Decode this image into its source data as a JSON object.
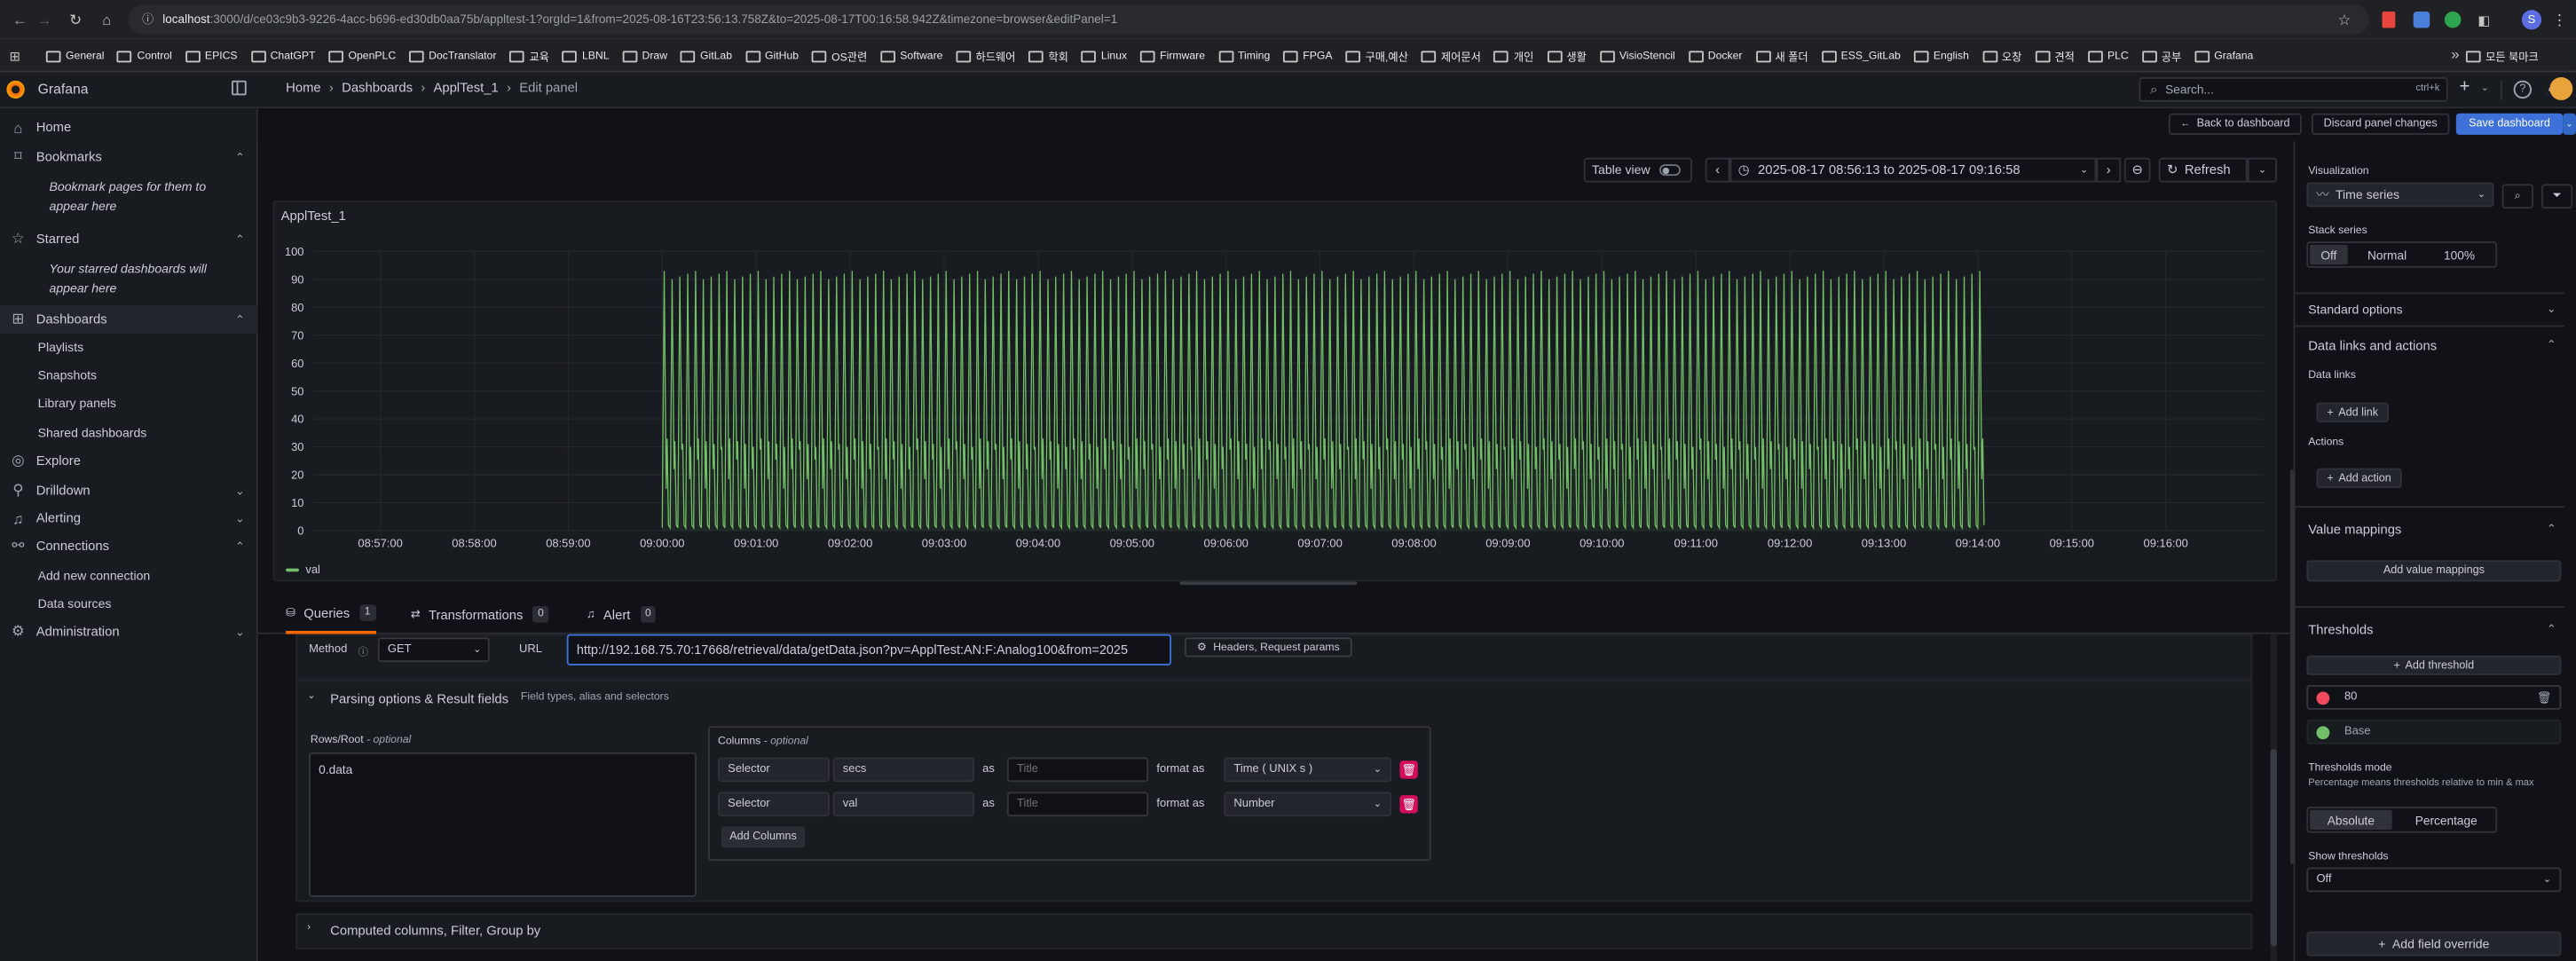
{
  "browser": {
    "url_host": "localhost",
    "url_rest": ":3000/d/ce03c9b3-9226-4acc-b696-ed30db0aa75b/appltest-1?orgId=1&from=2025-08-16T23:56:13.758Z&to=2025-08-17T00:16:58.942Z&timezone=browser&editPanel=1",
    "bookmarks": [
      "General",
      "Control",
      "EPICS",
      "ChatGPT",
      "OpenPLC",
      "DocTranslator",
      "교육",
      "LBNL",
      "Draw",
      "GitLab",
      "GitHub",
      "OS관련",
      "Software",
      "하드웨어",
      "학회",
      "Linux",
      "Firmware",
      "Timing",
      "FPGA",
      "구매,예산",
      "제어문서",
      "개인",
      "생활",
      "VisioStencil",
      "Docker",
      "새 폴더",
      "ESS_GitLab",
      "English",
      "오창",
      "견적",
      "PLC",
      "공부",
      "Grafana"
    ],
    "bookmarks_more": "»",
    "all_bookmarks": "모든 북마크",
    "profile": "S"
  },
  "topbar": {
    "app_name": "Grafana",
    "breadcrumb": [
      "Home",
      "Dashboards",
      "ApplTest_1",
      "Edit panel"
    ],
    "search_placeholder": "Search...",
    "search_shortcut": "ctrl+k",
    "plus": "+"
  },
  "sidebar": {
    "home": "Home",
    "bookmarks": "Bookmarks",
    "bookmarks_hint": "Bookmark pages for them to appear here",
    "starred": "Starred",
    "starred_hint": "Your starred dashboards will appear here",
    "dashboards": "Dashboards",
    "playlists": "Playlists",
    "snapshots": "Snapshots",
    "library_panels": "Library panels",
    "shared_dashboards": "Shared dashboards",
    "explore": "Explore",
    "drilldown": "Drilldown",
    "alerting": "Alerting",
    "connections": "Connections",
    "add_new_connection": "Add new connection",
    "data_sources": "Data sources",
    "administration": "Administration"
  },
  "actions": {
    "back": "Back to dashboard",
    "discard": "Discard panel changes",
    "save": "Save dashboard"
  },
  "panel_toolbar": {
    "table_view": "Table view",
    "time_range": "2025-08-17 08:56:13 to 2025-08-17 09:16:58",
    "refresh": "Refresh"
  },
  "chart_data": {
    "type": "line",
    "title": "ApplTest_1",
    "xlabel": "",
    "ylabel": "",
    "ylim": [
      0,
      100
    ],
    "yticks": [
      "0",
      "10",
      "20",
      "30",
      "40",
      "50",
      "60",
      "70",
      "80",
      "90",
      "100"
    ],
    "xticks": [
      "08:57:00",
      "08:58:00",
      "08:59:00",
      "09:00:00",
      "09:01:00",
      "09:02:00",
      "09:03:00",
      "09:04:00",
      "09:05:00",
      "09:06:00",
      "09:07:00",
      "09:08:00",
      "09:09:00",
      "09:10:00",
      "09:11:00",
      "09:12:00",
      "09:13:00",
      "09:14:00",
      "09:15:00",
      "09:16:00"
    ],
    "x_start": "09:00:00",
    "x_end": "09:14:00",
    "series": [
      {
        "name": "val",
        "color": "#73bf69",
        "min": 0,
        "max": 93,
        "lower_band": [
          15,
          33
        ],
        "oscillation": "approx. 2 cycles per 10 s between ~0-5 and ~93 with intermediate excursions to ~15-33"
      }
    ],
    "legend": "bottom-left",
    "grid": true
  },
  "tabs": {
    "queries": "Queries",
    "queries_count": "1",
    "transformations": "Transformations",
    "transformations_count": "0",
    "alert": "Alert",
    "alert_count": "0"
  },
  "query": {
    "method_label": "Method",
    "method_value": "GET",
    "url_label": "URL",
    "url_value": "http://192.168.75.70:17668/retrieval/data/getData.json?pv=ApplTest:AN:F:Analog100&from=2025",
    "headers_button": "Headers, Request params",
    "parsing_title": "Parsing options & Result fields",
    "parsing_hint": "Field types, alias and selectors",
    "rows_label": "Rows/Root",
    "rows_optional": "- optional",
    "rows_value": "0.data",
    "columns_label": "Columns",
    "columns_optional": "- optional",
    "columns": [
      {
        "selector_label": "Selector",
        "selector": "secs",
        "as": "as",
        "title_placeholder": "Title",
        "format_label": "format as",
        "format": "Time ( UNIX s )"
      },
      {
        "selector_label": "Selector",
        "selector": "val",
        "as": "as",
        "title_placeholder": "Title",
        "format_label": "format as",
        "format": "Number"
      }
    ],
    "add_columns": "Add Columns",
    "computed_title": "Computed columns, Filter, Group by"
  },
  "options": {
    "visualization_label": "Visualization",
    "visualization": "Time series",
    "stack_label": "Stack series",
    "stack_options": [
      "Off",
      "Normal",
      "100%"
    ],
    "standard_options": "Standard options",
    "data_links_actions": "Data links and actions",
    "data_links_label": "Data links",
    "add_link": "Add link",
    "actions_label": "Actions",
    "add_action": "Add action",
    "value_mappings": "Value mappings",
    "add_value_mappings": "Add value mappings",
    "thresholds": "Thresholds",
    "add_threshold": "Add threshold",
    "threshold_value": "80",
    "threshold_base": "Base",
    "thresholds_mode": "Thresholds mode",
    "thresholds_mode_hint": "Percentage means thresholds relative to min & max",
    "mode_options": [
      "Absolute",
      "Percentage"
    ],
    "show_thresholds": "Show thresholds",
    "show_thresholds_value": "Off",
    "add_field_override": "Add field override",
    "colors": {
      "red": "#f2495c",
      "green": "#73bf69",
      "primary": "#3d71d9"
    }
  }
}
